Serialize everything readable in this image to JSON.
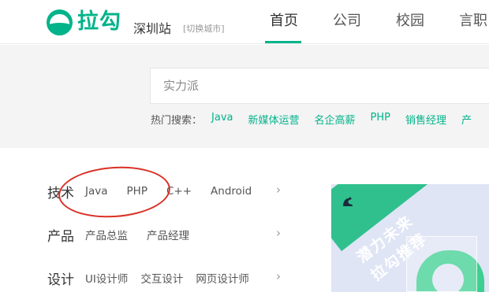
{
  "header": {
    "logo_text": "拉勾",
    "city": "深圳站",
    "city_switch": "[切换城市]",
    "nav": [
      "首页",
      "公司",
      "校园",
      "言职"
    ]
  },
  "search": {
    "placeholder": "实力派",
    "hot_label": "热门搜索：",
    "hot_links": [
      "Java",
      "新媒体运营",
      "名企高薪",
      "PHP",
      "销售经理",
      "产"
    ]
  },
  "categories": [
    {
      "title": "技术",
      "subs": [
        "Java",
        "PHP",
        "C++",
        "Android"
      ]
    },
    {
      "title": "产品",
      "subs": [
        "产品总监",
        "产品经理"
      ]
    },
    {
      "title": "设计",
      "subs": [
        "UI设计师",
        "交互设计",
        "网页设计师"
      ]
    }
  ],
  "arrow": "›",
  "banner": {
    "line1": "潜力未来",
    "line2": "拉勾推荐"
  },
  "colors": {
    "brand": "#00b38a",
    "annotation": "#d93025"
  }
}
